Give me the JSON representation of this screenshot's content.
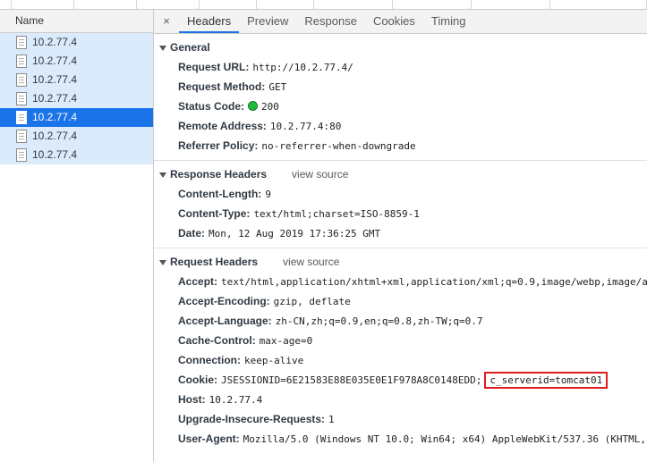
{
  "left": {
    "column_header": "Name",
    "requests": [
      {
        "name": "10.2.77.4",
        "selected": false
      },
      {
        "name": "10.2.77.4",
        "selected": false
      },
      {
        "name": "10.2.77.4",
        "selected": false
      },
      {
        "name": "10.2.77.4",
        "selected": false
      },
      {
        "name": "10.2.77.4",
        "selected": true
      },
      {
        "name": "10.2.77.4",
        "selected": false
      },
      {
        "name": "10.2.77.4",
        "selected": false
      }
    ]
  },
  "tabs": {
    "close": "×",
    "items": [
      "Headers",
      "Preview",
      "Response",
      "Cookies",
      "Timing"
    ],
    "active": "Headers"
  },
  "general": {
    "title": "General",
    "request_url": {
      "key": "Request URL:",
      "value": "http://10.2.77.4/"
    },
    "request_method": {
      "key": "Request Method:",
      "value": "GET"
    },
    "status_code": {
      "key": "Status Code:",
      "value": "200",
      "status_color": "#20b93b"
    },
    "remote_address": {
      "key": "Remote Address:",
      "value": "10.2.77.4:80"
    },
    "referrer_policy": {
      "key": "Referrer Policy:",
      "value": "no-referrer-when-downgrade"
    }
  },
  "response_headers": {
    "title": "Response Headers",
    "view_source": "view source",
    "content_length": {
      "key": "Content-Length:",
      "value": "9"
    },
    "content_type": {
      "key": "Content-Type:",
      "value": "text/html;charset=ISO-8859-1"
    },
    "date": {
      "key": "Date:",
      "value": "Mon, 12 Aug 2019 17:36:25 GMT"
    }
  },
  "request_headers": {
    "title": "Request Headers",
    "view_source": "view source",
    "accept": {
      "key": "Accept:",
      "value": "text/html,application/xhtml+xml,application/xml;q=0.9,image/webp,image/a"
    },
    "accept_encoding": {
      "key": "Accept-Encoding:",
      "value": "gzip, deflate"
    },
    "accept_language": {
      "key": "Accept-Language:",
      "value": "zh-CN,zh;q=0.9,en;q=0.8,zh-TW;q=0.7"
    },
    "cache_control": {
      "key": "Cache-Control:",
      "value": "max-age=0"
    },
    "connection": {
      "key": "Connection:",
      "value": "keep-alive"
    },
    "cookie": {
      "key": "Cookie:",
      "value": "JSESSIONID=6E21583E88E035E0E1F978A8C0148EDD;",
      "highlighted": "c_serverid=tomcat01",
      "highlight_color": "#e01c1c"
    },
    "host": {
      "key": "Host:",
      "value": "10.2.77.4"
    },
    "upgrade_insecure_requests": {
      "key": "Upgrade-Insecure-Requests:",
      "value": "1"
    },
    "user_agent": {
      "key": "User-Agent:",
      "value": "Mozilla/5.0 (Windows NT 10.0; Win64; x64) AppleWebKit/537.36 (KHTML,"
    }
  }
}
